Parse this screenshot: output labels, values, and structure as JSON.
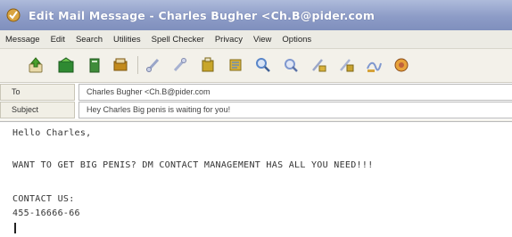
{
  "window": {
    "title": "Edit Mail Message - Charles Bugher <Ch.B@pider.com"
  },
  "menu": {
    "items": [
      "Message",
      "Edit",
      "Search",
      "Utilities",
      "Spell Checker",
      "Privacy",
      "View",
      "Options"
    ]
  },
  "toolbar": {
    "buttons": [
      {
        "name": "send-icon",
        "color": "#4aa02c"
      },
      {
        "name": "save-icon",
        "color": "#2f8a32"
      },
      {
        "name": "address-book-icon",
        "color": "#3f8c3a"
      },
      {
        "name": "attach-icon",
        "color": "#c28a1d"
      },
      {
        "name": "cut-icon",
        "color": "#9aa6c9"
      },
      {
        "name": "copy-icon",
        "color": "#a7b2d2"
      },
      {
        "name": "paste-icon",
        "color": "#c8a62a"
      },
      {
        "name": "find-icon",
        "color": "#d6b13a"
      },
      {
        "name": "spell-check-icon",
        "color": "#5a86c9"
      },
      {
        "name": "format-icon",
        "color": "#7f98cf"
      },
      {
        "name": "priority-icon",
        "color": "#d9b23b"
      },
      {
        "name": "encrypt-icon",
        "color": "#c9a330"
      },
      {
        "name": "signature-icon",
        "color": "#d6a33a"
      },
      {
        "name": "options-icon",
        "color": "#c0613a"
      }
    ]
  },
  "fields": {
    "to_label": "To",
    "to_value": "Charles Bugher <Ch.B@pider.com",
    "subject_label": "Subject",
    "subject_value": "Hey Charles Big penis is waiting for you!"
  },
  "body": {
    "lines": [
      "Hello Charles,",
      "WANT TO GET BIG PENIS? DM CONTACT MANAGEMENT HAS ALL YOU NEED!!!",
      "CONTACT US:",
      "455-16666-66"
    ]
  }
}
